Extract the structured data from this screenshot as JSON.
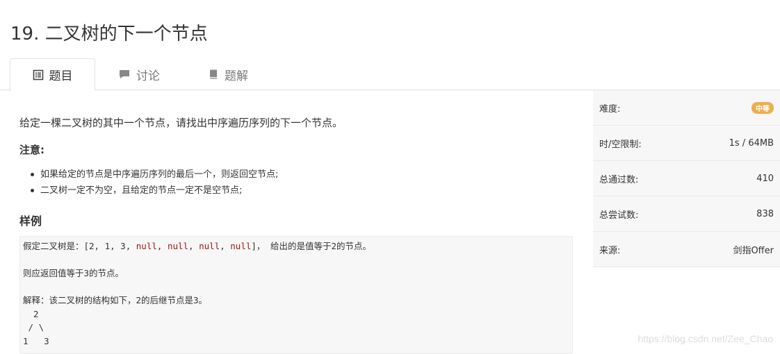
{
  "title": "19. 二叉树的下一个节点",
  "tabs": [
    {
      "label": "题目",
      "icon": "list-icon",
      "active": true
    },
    {
      "label": "讨论",
      "icon": "chat-icon",
      "active": false
    },
    {
      "label": "题解",
      "icon": "book-icon",
      "active": false
    }
  ],
  "problem": {
    "description": "给定一棵二叉树的其中一个节点，请找出中序遍历序列的下一个节点。",
    "note_heading": "注意:",
    "notes": [
      "如果给定的节点是中序遍历序列的最后一个，则返回空节点;",
      "二叉树一定不为空，且给定的节点一定不是空节点;"
    ],
    "example_heading": "样例",
    "example": {
      "line1_prefix": "假定二叉树是：[2, 1, 3, ",
      "null_tokens": [
        "null",
        "null",
        "null",
        "null"
      ],
      "line1_suffix": "]， 给出的是值等于2的节点。",
      "line2": "则应返回值等于3的节点。",
      "line3": "解释：该二叉树的结构如下，2的后继节点是3。",
      "tree": [
        "  2",
        " / \\",
        "1   3"
      ]
    }
  },
  "info": {
    "difficulty_label": "难度:",
    "difficulty_value": "中等",
    "limit_label": "时/空限制:",
    "limit_value": "1s / 64MB",
    "passed_label": "总通过数:",
    "passed_value": "410",
    "attempts_label": "总尝试数:",
    "attempts_value": "838",
    "source_label": "来源:",
    "source_value": "剑指Offer"
  },
  "colors": {
    "badge": "#f0ad4e",
    "null_keyword": "#a31515"
  },
  "watermark": "https://blog.csdn.net/Zee_Chao"
}
